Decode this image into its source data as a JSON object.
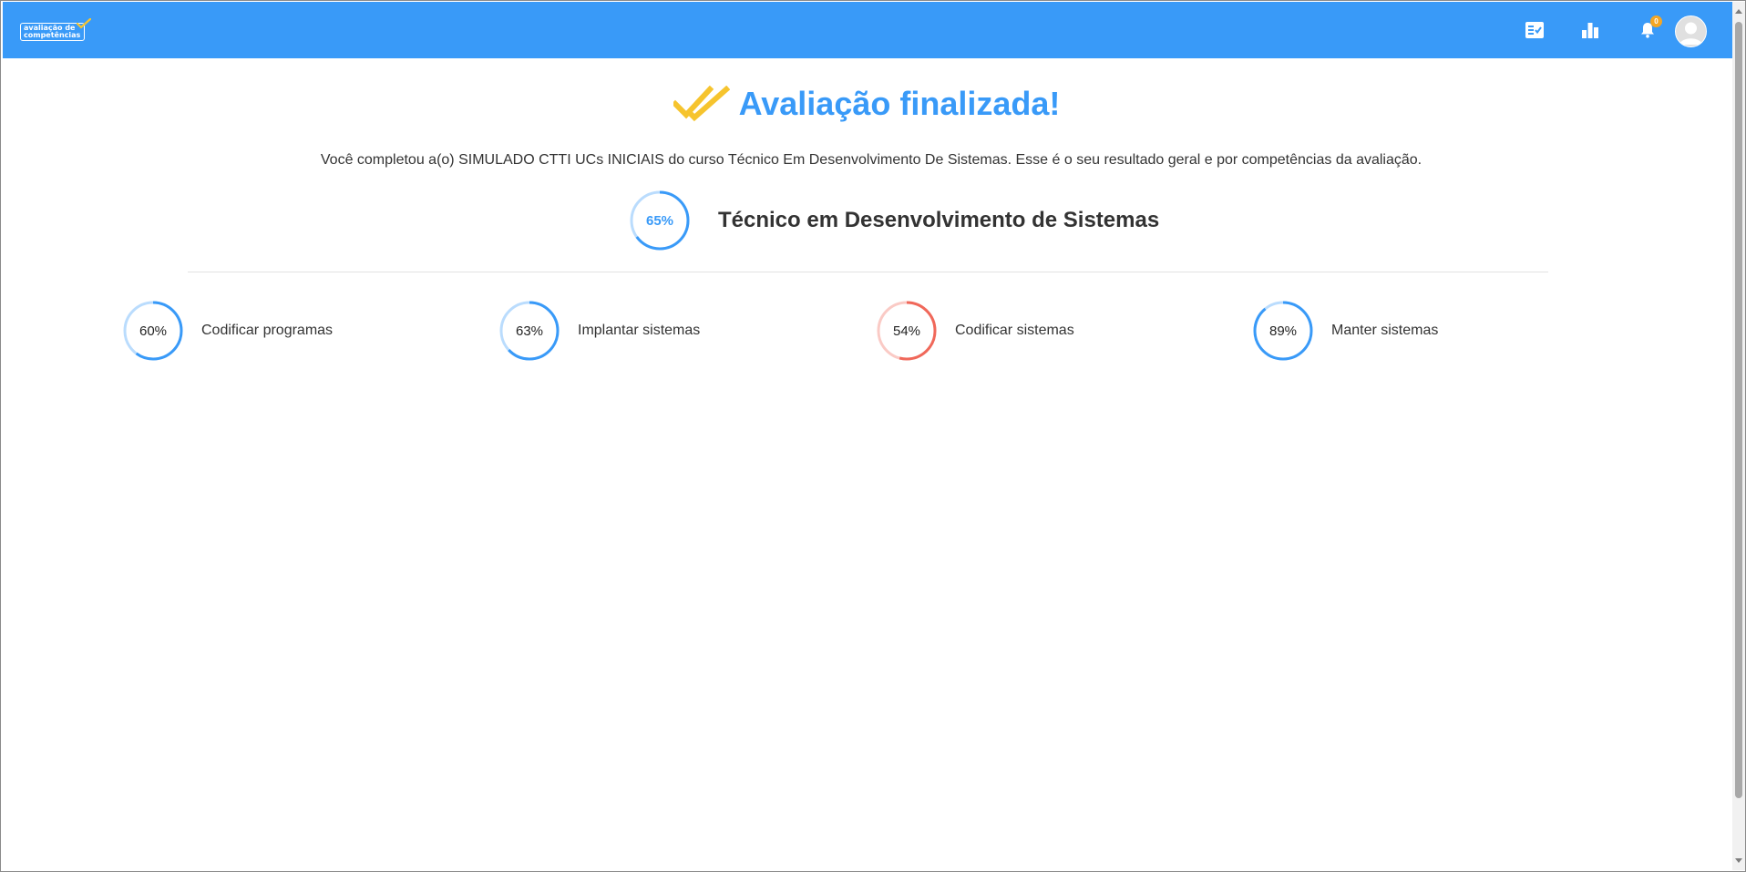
{
  "header": {
    "logo_line1": "avaliação de",
    "logo_line2": "competências",
    "icons": [
      "assessment-list-icon",
      "bar-chart-icon",
      "bell-icon",
      "avatar"
    ],
    "notification_count": "0",
    "accent_color": "#399af8",
    "badge_color": "#f5a623"
  },
  "page": {
    "title": "Avaliação finalizada!",
    "title_icon": "double-check-icon",
    "title_icon_color": "#f6c42e",
    "summary": "Você completou a(o) SIMULADO CTTI UCs INICIAIS do curso Técnico Em Desenvolvimento De Sistemas. Esse é o seu resultado geral e por competências da avaliação."
  },
  "course": {
    "name": "Técnico em Desenvolvimento de Sistemas",
    "percent_label": "65%",
    "percent": 65,
    "color": "#399af8"
  },
  "competencies": [
    {
      "label": "Codificar programas",
      "percent_label": "60%",
      "percent": 60,
      "color": "#399af8"
    },
    {
      "label": "Implantar sistemas",
      "percent_label": "63%",
      "percent": 63,
      "color": "#399af8"
    },
    {
      "label": "Codificar sistemas",
      "percent_label": "54%",
      "percent": 54,
      "color": "#f0685a"
    },
    {
      "label": "Manter sistemas",
      "percent_label": "89%",
      "percent": 89,
      "color": "#399af8"
    }
  ]
}
